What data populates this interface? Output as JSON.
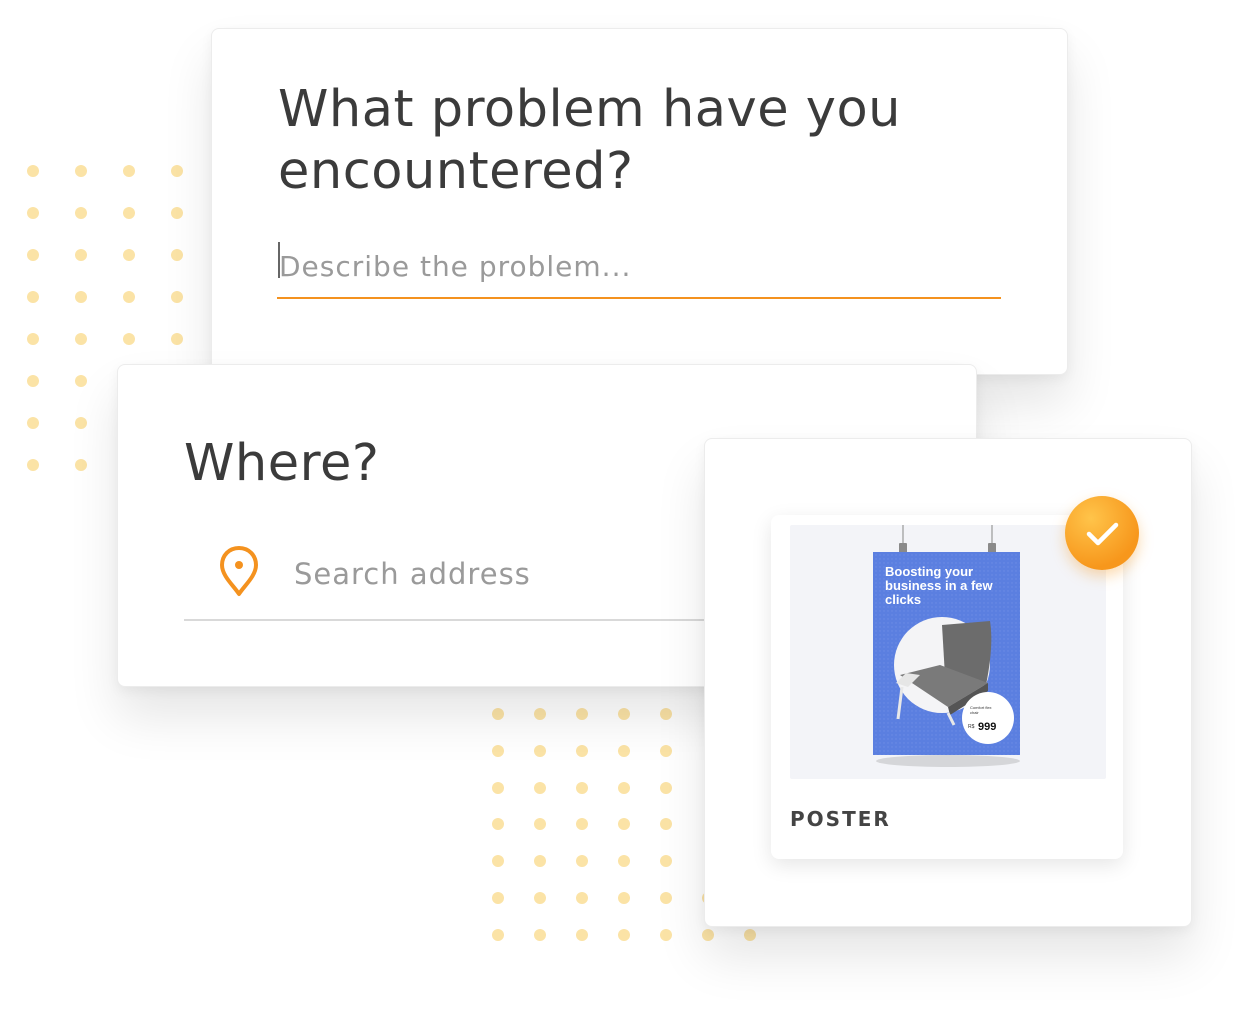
{
  "problem_card": {
    "title": "What problem have you encountered?",
    "input_placeholder": "Describe the problem..."
  },
  "where_card": {
    "title": "Where?",
    "search_placeholder": "Search address",
    "icon": "map-pin-icon"
  },
  "product_card": {
    "label": "POSTER",
    "selected": true,
    "check_icon": "check-icon",
    "poster": {
      "headline": "Boosting your business in a few clicks",
      "caption": "Comfort flex chair",
      "currency": "R$",
      "price": "999"
    }
  },
  "colors": {
    "accent": "#f4921f",
    "dots": "#fbe3a6",
    "poster_blue": "#5b7fe0"
  }
}
